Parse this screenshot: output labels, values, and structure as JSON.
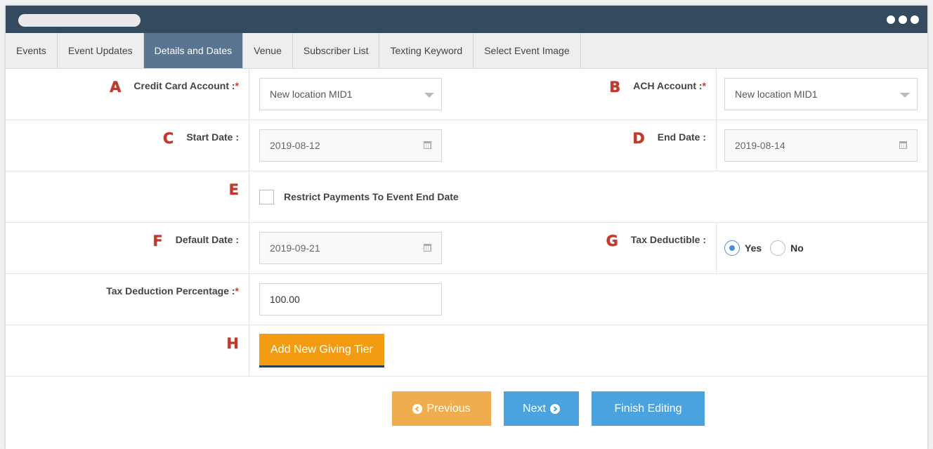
{
  "tabs": [
    {
      "label": "Events"
    },
    {
      "label": "Event Updates"
    },
    {
      "label": "Details and Dates"
    },
    {
      "label": "Venue"
    },
    {
      "label": "Subscriber List"
    },
    {
      "label": "Texting Keyword"
    },
    {
      "label": "Select Event Image"
    }
  ],
  "active_tab": "Details and Dates",
  "markers": [
    "A",
    "B",
    "C",
    "D",
    "E",
    "F",
    "G",
    "H"
  ],
  "form": {
    "credit_card_label": "Credit Card Account :",
    "credit_card_value": "New location MID1",
    "ach_label": "ACH Account :",
    "ach_value": "New location MID1",
    "start_date_label": "Start Date :",
    "start_date_value": "2019-08-12",
    "end_date_label": "End Date :",
    "end_date_value": "2019-08-14",
    "restrict_label": "Restrict Payments To Event End Date",
    "restrict_checked": false,
    "default_date_label": "Default Date :",
    "default_date_value": "2019-09-21",
    "tax_deductible_label": "Tax Deductible :",
    "tax_yes": "Yes",
    "tax_no": "No",
    "tax_selected": "Yes",
    "tax_pct_label": "Tax Deduction Percentage :",
    "tax_pct_value": "100.00",
    "required_mark": "*"
  },
  "buttons": {
    "add_tier": "Add New Giving Tier",
    "previous": "Previous",
    "next": "Next",
    "finish": "Finish Editing"
  },
  "colors": {
    "titlebar": "#344a5e",
    "active_tab": "#5a7591",
    "orange": "#f39c12",
    "blue": "#4aa3df",
    "marker": "#c0392b"
  }
}
